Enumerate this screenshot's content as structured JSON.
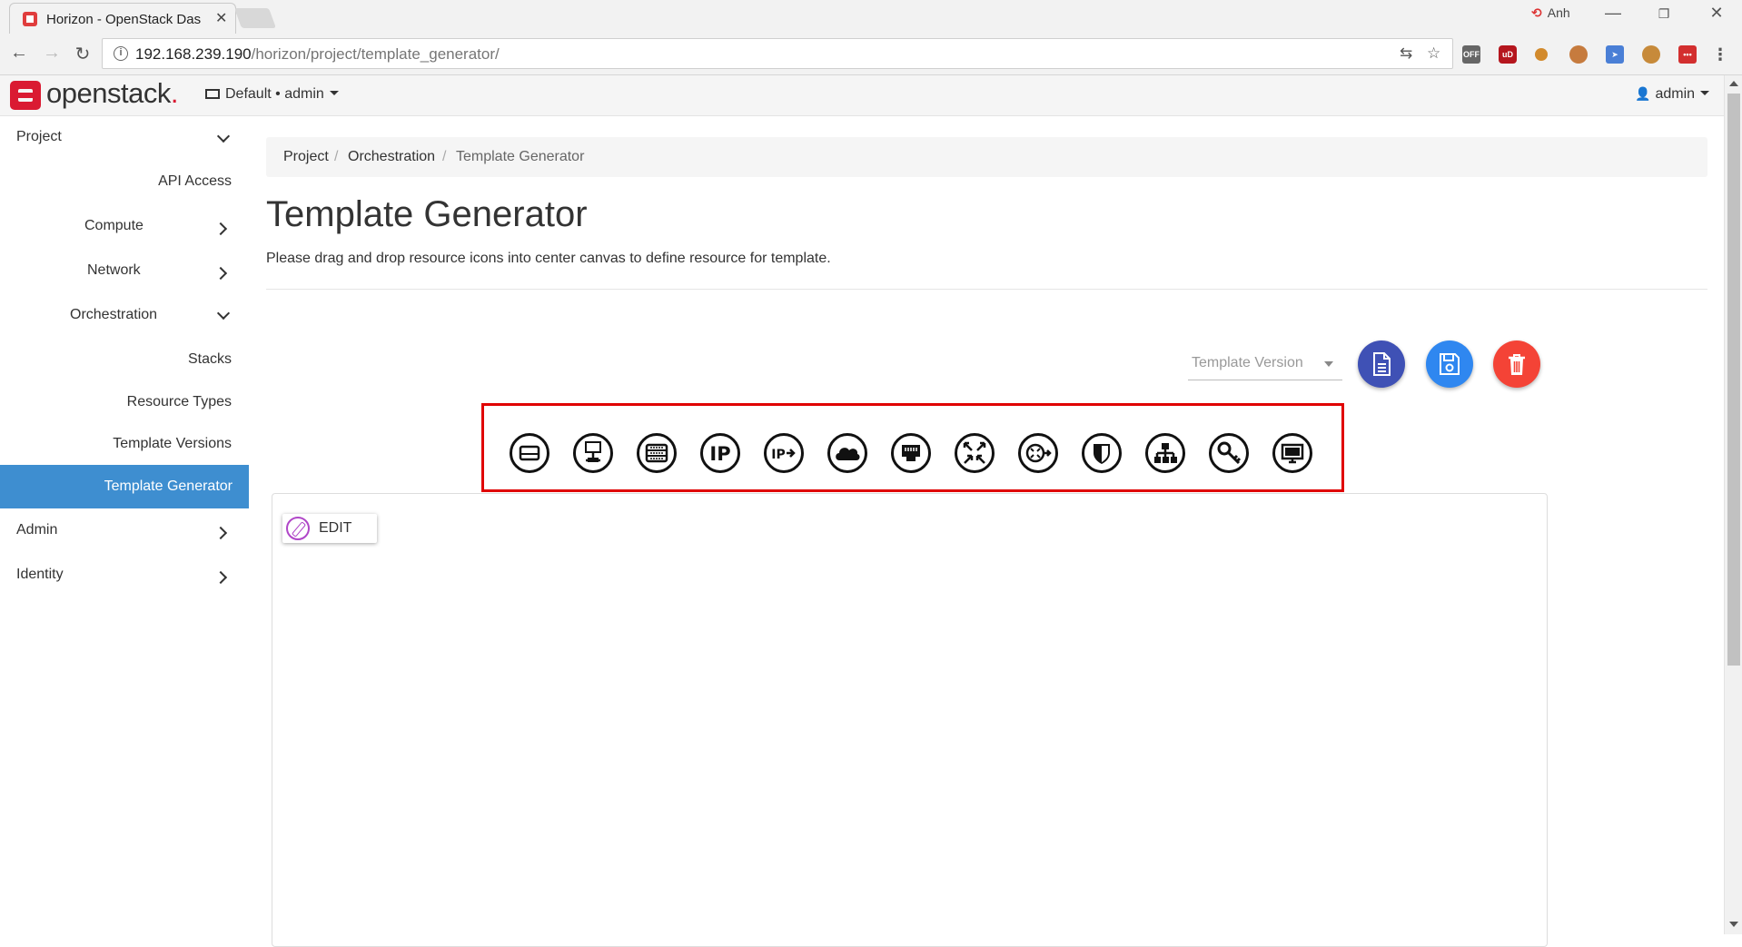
{
  "browser": {
    "tab_title": "Horizon - OpenStack Das",
    "user_label": "Anh",
    "url_host": "192.168.239.190",
    "url_path": "/horizon/project/template_generator/"
  },
  "header": {
    "logo_text": "openstack",
    "logo_dot": ".",
    "project_switcher": "Default • admin",
    "user_menu": "admin"
  },
  "sidebar": {
    "items": [
      {
        "label": "Project"
      },
      {
        "label": "API Access"
      },
      {
        "label": "Compute"
      },
      {
        "label": "Network"
      },
      {
        "label": "Orchestration"
      },
      {
        "label": "Stacks"
      },
      {
        "label": "Resource Types"
      },
      {
        "label": "Template Versions"
      },
      {
        "label": "Template Generator"
      },
      {
        "label": "Admin"
      },
      {
        "label": "Identity"
      }
    ],
    "active_color": "#3e8ed0"
  },
  "breadcrumb": [
    "Project",
    "Orchestration",
    "Template Generator"
  ],
  "page": {
    "title": "Template Generator",
    "description": "Please drag and drop resource icons into center canvas to define resource for template."
  },
  "toolbar": {
    "template_version_placeholder": "Template Version",
    "buttons": [
      {
        "icon": "document-icon",
        "color": "#3f51b5"
      },
      {
        "icon": "save-icon",
        "color": "#2f87f0"
      },
      {
        "icon": "trash-icon",
        "color": "#f44336"
      }
    ]
  },
  "resource_icons": [
    "volume-icon",
    "server-instance-icon",
    "server-group-icon",
    "floating-ip-icon",
    "floating-ip-association-icon",
    "cloud-icon",
    "port-icon",
    "router-icon",
    "router-interface-icon",
    "security-group-icon",
    "network-icon",
    "key-pair-icon",
    "monitor-icon"
  ],
  "canvas": {
    "edit_label": "EDIT",
    "edit_icon_color": "#b046c8"
  }
}
